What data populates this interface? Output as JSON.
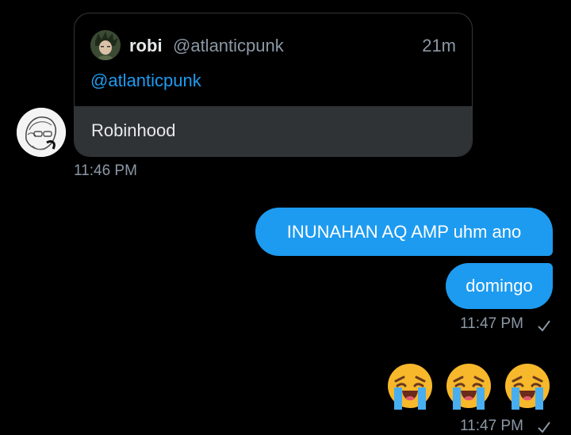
{
  "incoming": {
    "quoted_tweet": {
      "display_name": "robi",
      "handle": "@atlanticpunk",
      "time_ago": "21m",
      "mention": "@atlanticpunk"
    },
    "message_text": "Robinhood",
    "timestamp": "11:46 PM"
  },
  "outgoing": {
    "messages": [
      {
        "text": "INUNAHAN AQ AMP uhm ano"
      },
      {
        "text": "domingo"
      }
    ],
    "timestamp": "11:47 PM",
    "status_icon": "check-icon"
  },
  "outgoing_emoji": {
    "emoji": "loudly-crying-face",
    "count": 3,
    "timestamp": "11:47 PM",
    "status_icon": "check-icon"
  },
  "colors": {
    "background": "#000000",
    "bubble": "#1d9bf0",
    "link": "#1d9bf0",
    "muted": "#8b98a5",
    "card_bottom": "#2f3336"
  }
}
